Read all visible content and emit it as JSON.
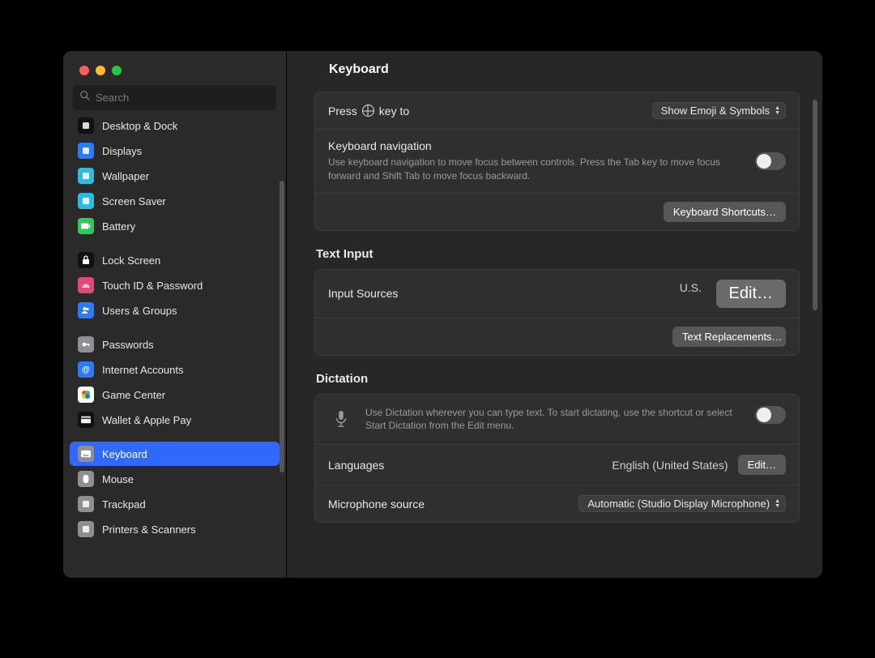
{
  "window": {
    "title": "Keyboard"
  },
  "search": {
    "placeholder": "Search"
  },
  "sidebar": {
    "items": [
      {
        "label": "Desktop & Dock",
        "bg": "#111",
        "selected": false
      },
      {
        "label": "Displays",
        "bg": "#2c7bf6",
        "selected": false
      },
      {
        "label": "Wallpaper",
        "bg": "#2dbce0",
        "selected": false
      },
      {
        "label": "Screen Saver",
        "bg": "#2dbce0",
        "selected": false
      },
      {
        "label": "Battery",
        "bg": "#34c759",
        "selected": false
      },
      {
        "label": "Lock Screen",
        "bg": "#111",
        "selected": false
      },
      {
        "label": "Touch ID & Password",
        "bg": "#e04a7a",
        "selected": false
      },
      {
        "label": "Users & Groups",
        "bg": "#2c7bf6",
        "selected": false
      },
      {
        "label": "Passwords",
        "bg": "#8e8e93",
        "selected": false
      },
      {
        "label": "Internet Accounts",
        "bg": "#2c7bf6",
        "selected": false
      },
      {
        "label": "Game Center",
        "bg": "#ffffff",
        "selected": false
      },
      {
        "label": "Wallet & Apple Pay",
        "bg": "#111",
        "selected": false
      },
      {
        "label": "Keyboard",
        "bg": "#8e8e93",
        "selected": true
      },
      {
        "label": "Mouse",
        "bg": "#8e8e93",
        "selected": false
      },
      {
        "label": "Trackpad",
        "bg": "#8e8e93",
        "selected": false
      },
      {
        "label": "Printers & Scanners",
        "bg": "#8e8e93",
        "selected": false
      }
    ],
    "group_breaks": [
      5,
      8,
      12
    ]
  },
  "keyboard": {
    "press_row": {
      "label_prefix": "Press",
      "label_suffix": "key to",
      "value": "Show Emoji & Symbols"
    },
    "nav_row": {
      "title": "Keyboard navigation",
      "desc": "Use keyboard navigation to move focus between controls. Press the Tab key to move focus forward and Shift Tab to move focus backward.",
      "on": false
    },
    "shortcuts_btn": "Keyboard Shortcuts…"
  },
  "text_input": {
    "heading": "Text Input",
    "input_sources": {
      "label": "Input Sources",
      "value": "U.S.",
      "edit_btn": "Edit…"
    },
    "text_replace_btn": "Text Replacements…"
  },
  "dictation": {
    "heading": "Dictation",
    "desc": "Use Dictation wherever you can type text. To start dictating, use the shortcut or select Start Dictation from the Edit menu.",
    "on": false,
    "languages": {
      "label": "Languages",
      "value": "English (United States)",
      "edit_btn": "Edit…"
    },
    "mic": {
      "label": "Microphone source",
      "value": "Automatic (Studio Display Microphone)"
    }
  },
  "annotation": {
    "highlight_target": "input-sources-edit-button"
  }
}
